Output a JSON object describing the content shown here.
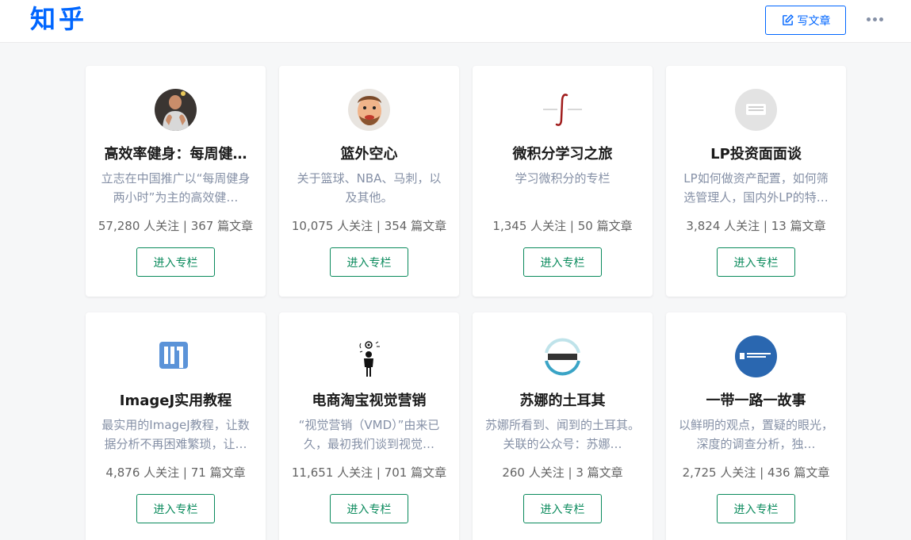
{
  "header": {
    "logo": "知乎",
    "write_label": "写文章",
    "brand_color": "#0066ff"
  },
  "columns": [
    {
      "title": "高效率健身：每周健…",
      "desc": "立志在中国推广以“每周健身两小时”为主的高效健…",
      "stats": "57,280 人关注 | 367 篇文章",
      "button": "进入专栏",
      "avatar": "person-photo"
    },
    {
      "title": "篮外空心",
      "desc": "关于篮球、NBA、马刺，以及其他。",
      "stats": "10,075 人关注 | 354 篇文章",
      "button": "进入专栏",
      "avatar": "cartoon-face"
    },
    {
      "title": "微积分学习之旅",
      "desc": "学习微积分的专栏",
      "stats": "1,345 人关注 | 50 篇文章",
      "button": "进入专栏",
      "avatar": "integral-sign"
    },
    {
      "title": "LP投资面面谈",
      "desc": "LP如何做资产配置，如何筛选管理人，国内外LP的特…",
      "stats": "3,824 人关注 | 13 篇文章",
      "button": "进入专栏",
      "avatar": "default-placeholder"
    },
    {
      "title": "ImageJ实用教程",
      "desc": "最实用的ImageJ教程，让数据分析不再困难繁琐，让…",
      "stats": "4,876 人关注 | 71 篇文章",
      "button": "进入专栏",
      "avatar": "imagej-logo"
    },
    {
      "title": "电商淘宝视觉营销",
      "desc": "“视觉营销（VMD）”由来已久，最初我们谈到视觉…",
      "stats": "11,651 人关注 | 701 篇文章",
      "button": "进入专栏",
      "avatar": "figure-icon"
    },
    {
      "title": "苏娜的土耳其",
      "desc": "苏娜所看到、闻到的土耳其。关联的公众号：苏娜…",
      "stats": "260 人关注 | 3 篇文章",
      "button": "进入专栏",
      "avatar": "suna-logo"
    },
    {
      "title": "一带一路一故事",
      "desc": "以鲜明的观点，置疑的眼光，深度的调查分析，独…",
      "stats": "2,725 人关注 | 436 篇文章",
      "button": "进入专栏",
      "avatar": "belt-road-logo"
    }
  ]
}
